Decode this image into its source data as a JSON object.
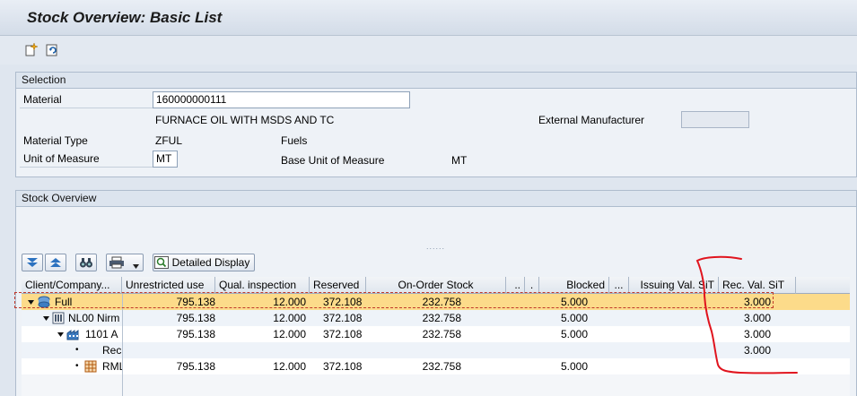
{
  "window": {
    "title": "Stock Overview: Basic List"
  },
  "toolbar": {
    "icons": [
      "new-entry-icon",
      "refresh-icon"
    ]
  },
  "selection": {
    "group_title": "Selection",
    "material_label": "Material",
    "material_value": "160000000111",
    "material_desc": "FURNACE OIL WITH MSDS AND TC",
    "ext_mfr_label": "External Manufacturer",
    "ext_mfr_value": "",
    "material_type_label": "Material Type",
    "material_type_code": "ZFUL",
    "material_type_desc": "Fuels",
    "uom_label": "Unit of Measure",
    "uom_value": "MT",
    "base_uom_label": "Base Unit of Measure",
    "base_uom_value": "MT"
  },
  "stock_overview": {
    "group_title": "Stock Overview",
    "resize_handle": "......",
    "detailed_display_label": "Detailed Display",
    "columns": [
      "Client/Company...",
      "Unrestricted use",
      "Qual. inspection",
      "Reserved",
      "On-Order Stock",
      "..",
      ".",
      "Blocked",
      "...",
      "Issuing Val. SiT",
      "Rec. Val. SiT"
    ],
    "rows": [
      {
        "label": "Full",
        "icon": "client-icon",
        "unrestricted": "795.138",
        "qual": "12.000",
        "reserved": "372.108",
        "onorder": "232.758",
        "blocked": "5.000",
        "rec_sit": "3.000"
      },
      {
        "label": "NL00 Nirm",
        "icon": "company-icon",
        "unrestricted": "795.138",
        "qual": "12.000",
        "reserved": "372.108",
        "onorder": "232.758",
        "blocked": "5.000",
        "rec_sit": "3.000"
      },
      {
        "label": "1101 A",
        "icon": "plant-icon",
        "unrestricted": "795.138",
        "qual": "12.000",
        "reserved": "372.108",
        "onorder": "232.758",
        "blocked": "5.000",
        "rec_sit": "3.000"
      },
      {
        "label": "Rec",
        "icon": "bullet",
        "unrestricted": "",
        "qual": "",
        "reserved": "",
        "onorder": "",
        "blocked": "",
        "rec_sit": "3.000"
      },
      {
        "label": "RML",
        "icon": "storage-location-icon",
        "unrestricted": "795.138",
        "qual": "12.000",
        "reserved": "372.108",
        "onorder": "232.758",
        "blocked": "5.000",
        "rec_sit": ""
      }
    ]
  },
  "colors": {
    "selected_row": "#fcdb8a",
    "annotation": "#e0141e"
  }
}
